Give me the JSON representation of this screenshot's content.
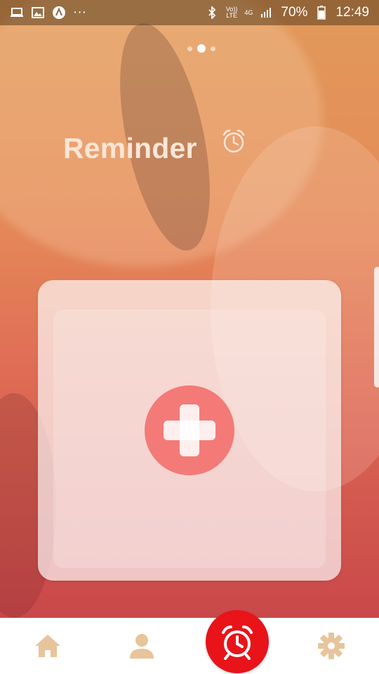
{
  "status_bar": {
    "left_icons": [
      "laptop-icon",
      "image-icon",
      "app-a-icon",
      "more-dots-icon"
    ],
    "more_label": "···",
    "volte_label_top": "Vo))",
    "volte_label_bottom": "LTE",
    "network_label": "4G",
    "battery_percent": "70%",
    "time": "12:49"
  },
  "pager": {
    "pages": 3,
    "active_index": 1
  },
  "header": {
    "title": "Reminder",
    "icon": "alarm-clock-icon"
  },
  "card": {
    "add_button_icon": "plus-icon"
  },
  "bottom_nav": {
    "items": [
      {
        "name": "home",
        "icon": "home-icon"
      },
      {
        "name": "profile",
        "icon": "person-icon"
      },
      {
        "name": "reminder",
        "icon": "alarm-clock-icon",
        "active": true
      },
      {
        "name": "settings",
        "icon": "gear-icon"
      }
    ]
  },
  "colors": {
    "accent_red": "#e8141a",
    "add_button": "#f47a77",
    "nav_icon": "#e8c49a",
    "title_text": "#fbe6d6"
  }
}
